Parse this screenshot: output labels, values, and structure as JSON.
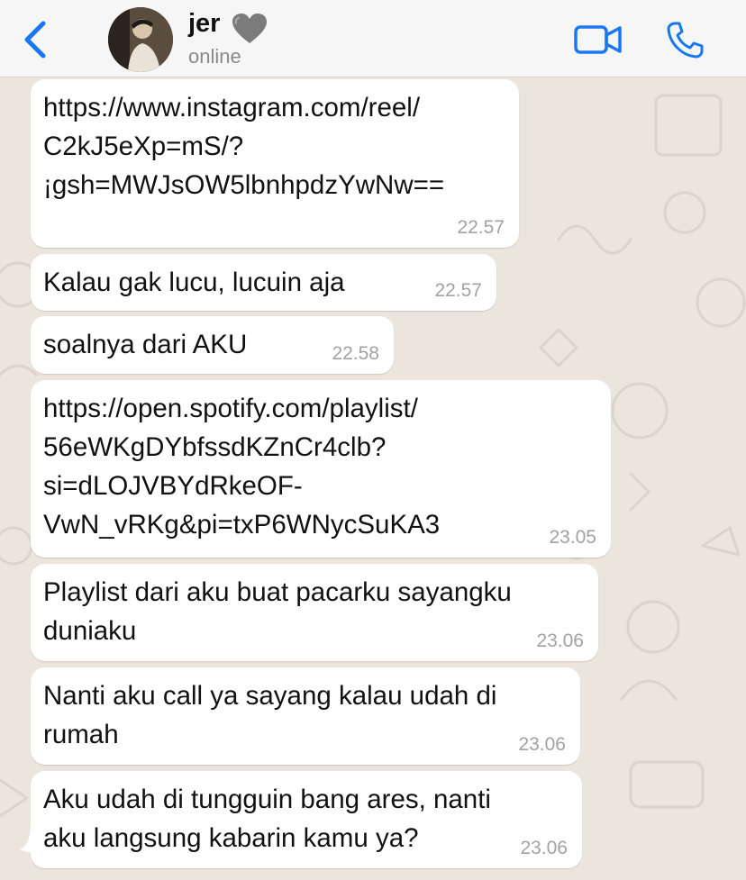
{
  "header": {
    "contact_name": "jer",
    "status": "online",
    "colors": {
      "accent": "#1877f2",
      "heart": "#7b7b7b"
    },
    "icons": [
      "chevron-left-icon",
      "gray-heart-icon",
      "video-camera-icon",
      "phone-icon"
    ]
  },
  "messages": [
    {
      "text": "https://www.instagram.com/reel/\nC2kJ5eXp=mS/?\n¡gsh=MWJsOW5lbnhpdzYwNw==",
      "time": "22.57"
    },
    {
      "text": "Kalau gak lucu, lucuin aja",
      "time": "22.57"
    },
    {
      "text": "soalnya dari AKU",
      "time": "22.58"
    },
    {
      "text": "https://open.spotify.com/playlist/\n56eWKgDYbfssdKZnCr4clb?\nsi=dLOJVBYdRkeOF-\nVwN_vRKg&pi=txP6WNycSuKA3",
      "time": "23.05"
    },
    {
      "text": "Playlist dari aku buat pacarku sayangku\nduniaku",
      "time": "23.06"
    },
    {
      "text": "Nanti aku call ya sayang kalau udah di\nrumah",
      "time": "23.06"
    },
    {
      "text": "Aku udah di tungguin bang ares, nanti\naku langsung kabarin kamu ya?",
      "time": "23.06"
    }
  ]
}
